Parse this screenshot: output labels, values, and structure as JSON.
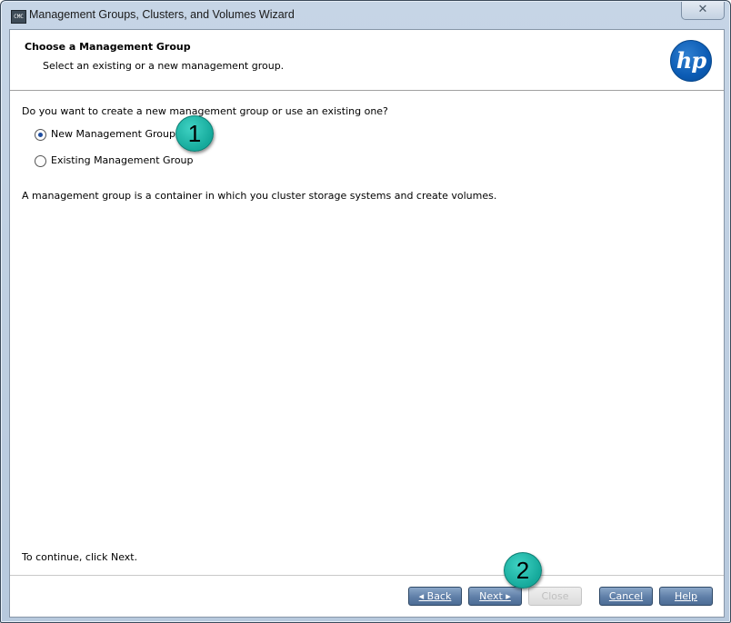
{
  "window": {
    "title": "Management Groups, Clusters, and Volumes Wizard",
    "icon_text": "CMC",
    "close_glyph": "✕"
  },
  "header": {
    "title": "Choose a Management Group",
    "subtitle": "Select an existing or a new management group.",
    "logo_text": "hp"
  },
  "body": {
    "question": "Do you want to create a new management group or use an existing one?",
    "options": [
      {
        "label": "New Management Group",
        "selected": true
      },
      {
        "label": "Existing Management Group",
        "selected": false
      }
    ],
    "description": "A management group is a container in which you cluster storage systems and create volumes.",
    "continue_hint": "To continue, click Next."
  },
  "buttons": {
    "back": "◂ Back",
    "next": "Next ▸",
    "close": "Close",
    "cancel": "Cancel",
    "help": "Help"
  },
  "callouts": {
    "step1": "1",
    "step2": "2"
  },
  "colors": {
    "accent_button": "#5f7fa8",
    "callout": "#15a99b",
    "hp_logo": "#0b5bb4"
  }
}
